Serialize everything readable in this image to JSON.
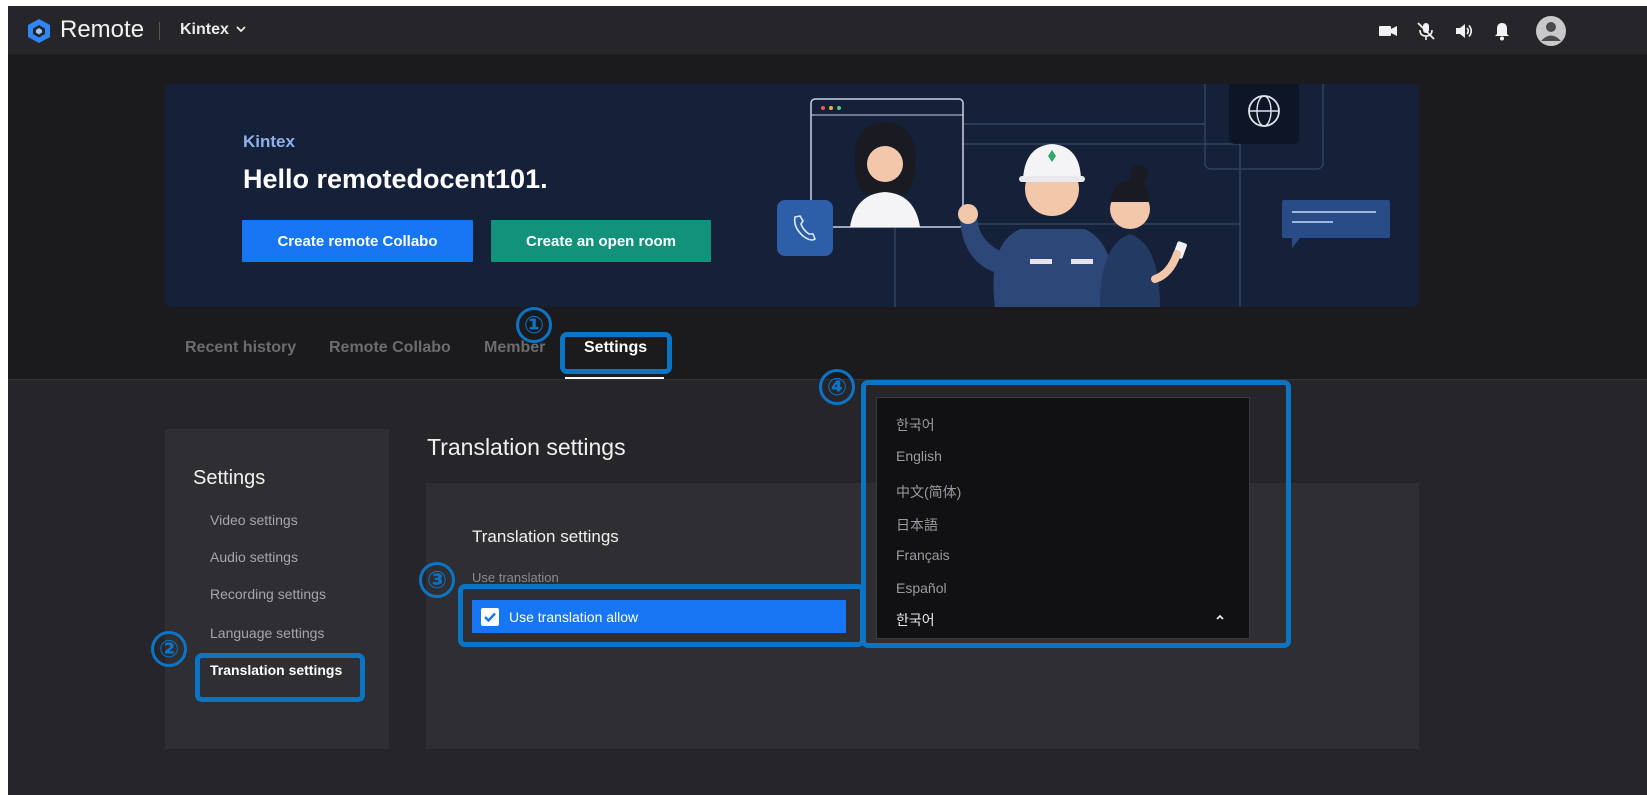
{
  "topbar": {
    "app_title": "Remote",
    "workspace": "Kintex",
    "icons": [
      "video-camera-icon",
      "mic-muted-icon",
      "speaker-icon",
      "bell-icon",
      "user-avatar-icon"
    ]
  },
  "hero": {
    "org": "Kintex",
    "greeting": "Hello remotedocent101.",
    "create_collabo_label": "Create remote Collabo",
    "create_open_room_label": "Create an open room"
  },
  "tabs": [
    {
      "label": "Recent history"
    },
    {
      "label": "Remote Collabo"
    },
    {
      "label": "Member"
    },
    {
      "label": "Settings"
    }
  ],
  "settings_menu": {
    "title": "Settings",
    "items": [
      {
        "label": "Video settings"
      },
      {
        "label": "Audio settings"
      },
      {
        "label": "Recording settings"
      },
      {
        "label": "Language settings"
      },
      {
        "label": "Translation settings"
      }
    ]
  },
  "main": {
    "heading": "Translation settings",
    "card_title": "Translation settings",
    "use_label": "Use translation",
    "allow_label": "Use translation allow",
    "allow_checked": true
  },
  "language_dropdown": {
    "options": [
      "한국어",
      "English",
      "中文(简体)",
      "日本語",
      "Français",
      "Español"
    ],
    "selected": "한국어"
  },
  "annotations": [
    "①",
    "②",
    "③",
    "④"
  ],
  "colors": {
    "accent_blue": "#1676f3",
    "accent_green": "#12927a",
    "hero_bg": "#152039",
    "highlight": "#0c74c5"
  }
}
